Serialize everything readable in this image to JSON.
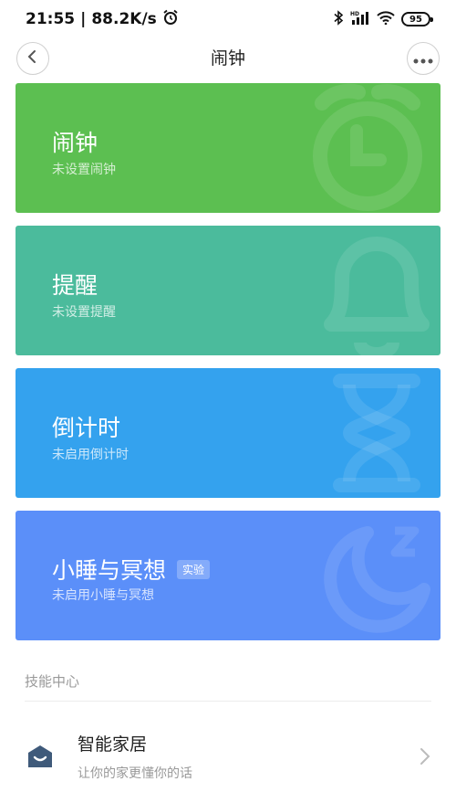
{
  "status_bar": {
    "time": "21:55",
    "speed": "88.2K/s",
    "battery": "95",
    "icons": [
      "alarm-clock-icon",
      "bluetooth-icon",
      "hd-signal-icon",
      "wifi-icon",
      "battery-icon"
    ]
  },
  "header": {
    "title": "闹钟",
    "back_icon": "chevron-left-icon",
    "more_icon": "more-dots-icon"
  },
  "cards": [
    {
      "title": "闹钟",
      "subtitle": "未设置闹钟",
      "color": "#5cbf51",
      "icon": "alarm-clock-icon"
    },
    {
      "title": "提醒",
      "subtitle": "未设置提醒",
      "color": "#4bbb9c",
      "icon": "bell-icon"
    },
    {
      "title": "倒计时",
      "subtitle": "未启用倒计时",
      "color": "#34a2ee",
      "icon": "hourglass-icon"
    },
    {
      "title": "小睡与冥想",
      "badge": "实验",
      "subtitle": "未启用小睡与冥想",
      "color": "#5b8ff9",
      "icon": "moon-icon"
    }
  ],
  "skill_center": {
    "label": "技能中心",
    "items": [
      {
        "title": "智能家居",
        "subtitle": "让你的家更懂你的话",
        "icon": "smart-home-icon"
      }
    ]
  },
  "colors": {
    "alarm": "#5cbf51",
    "reminder": "#4bbb9c",
    "timer": "#34a2ee",
    "nap": "#5b8ff9"
  }
}
